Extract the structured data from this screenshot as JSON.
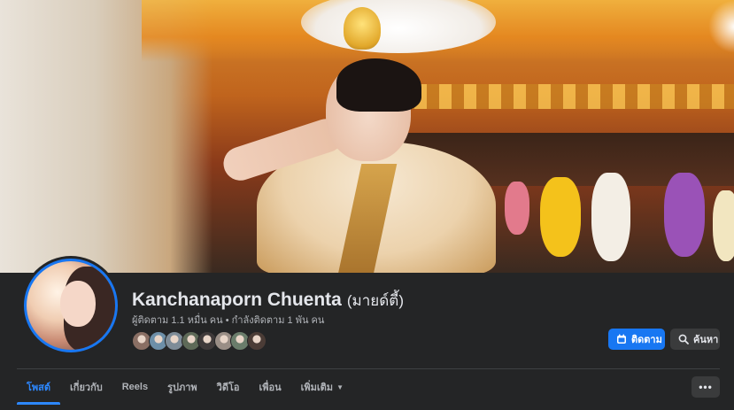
{
  "profile": {
    "name": "Kanchanaporn Chuenta",
    "alt_name": "(มายด์ตี้)",
    "followers_text": "ผู้ติดตาม 1.1 หมื่น คน",
    "separator": "•",
    "following_text": "กำลังติดตาม 1 พัน คน"
  },
  "friend_avatars": [
    {
      "name": "friend-avatar-1",
      "color": "#8a6f64"
    },
    {
      "name": "friend-avatar-2",
      "color": "#6d8fa8"
    },
    {
      "name": "friend-avatar-3",
      "color": "#7e8c98"
    },
    {
      "name": "friend-avatar-4",
      "color": "#5e6a58"
    },
    {
      "name": "friend-avatar-5",
      "color": "#3f3a3a"
    },
    {
      "name": "friend-avatar-6",
      "color": "#9a8e86"
    },
    {
      "name": "friend-avatar-7",
      "color": "#6a7d6b"
    },
    {
      "name": "friend-avatar-8",
      "color": "#4b3c36"
    }
  ],
  "actions": {
    "follow_label": "ติดตาม",
    "follow_icon": "user-plus-icon",
    "search_label": "ค้นหา",
    "search_icon": "search-icon"
  },
  "tabs": [
    {
      "label": "โพสต์",
      "active": true
    },
    {
      "label": "เกี่ยวกับ",
      "active": false
    },
    {
      "label": "Reels",
      "active": false
    },
    {
      "label": "รูปภาพ",
      "active": false
    },
    {
      "label": "วิดีโอ",
      "active": false
    },
    {
      "label": "เพื่อน",
      "active": false
    },
    {
      "label": "เพิ่มเติม",
      "active": false
    }
  ],
  "more_options_label": "•••",
  "colors": {
    "accent": "#1877f2",
    "active_tab": "#2d88ff",
    "background": "#242526"
  }
}
